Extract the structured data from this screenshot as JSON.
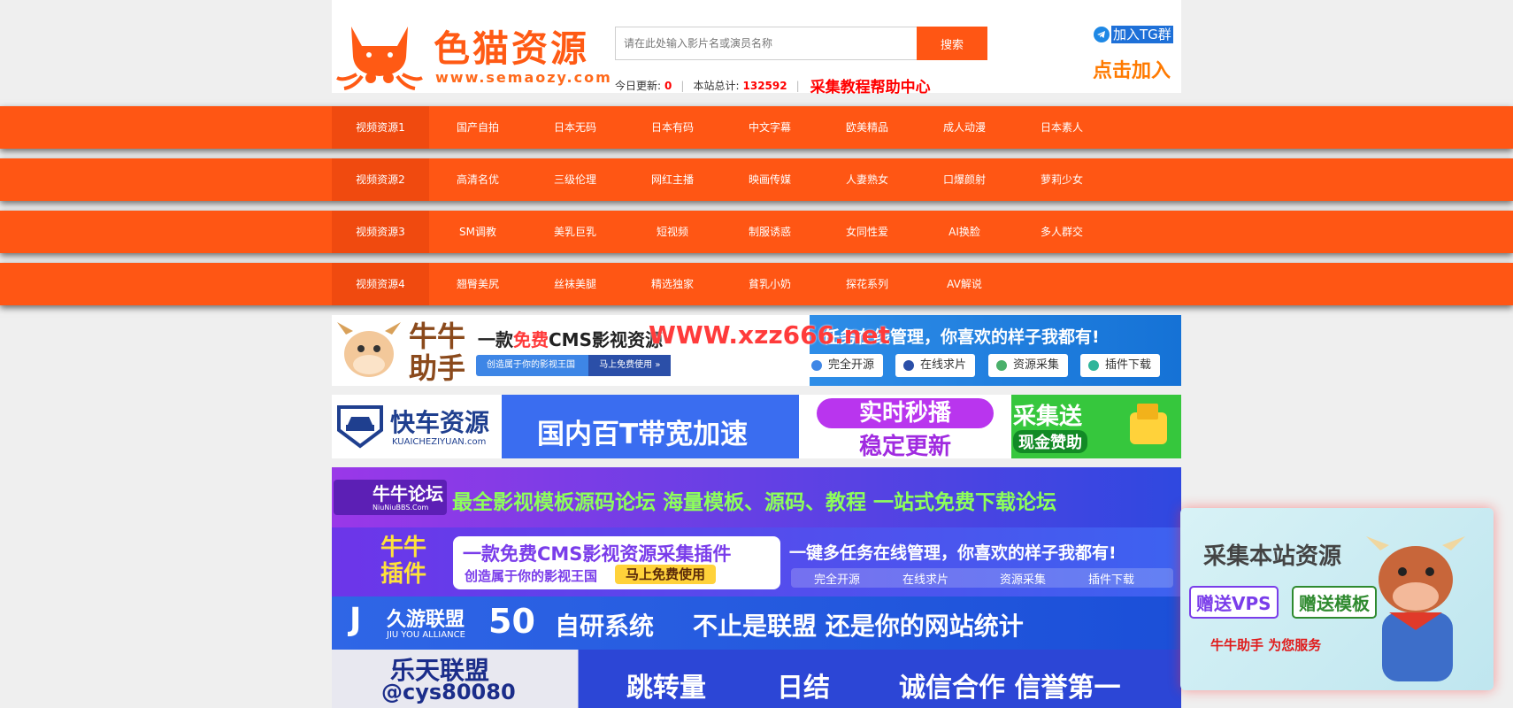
{
  "logo": {
    "name": "色猫资源",
    "url": "www.semaozy.com"
  },
  "search": {
    "placeholder": "请在此处输入影片名或演员名称",
    "button": "搜索"
  },
  "stats": {
    "today_label": "今日更新:",
    "today_value": "0",
    "total_label": "本站总计:",
    "total_value": "132592",
    "help": "采集教程帮助中心"
  },
  "tg": {
    "label": "加入TG群",
    "join": "点击加入"
  },
  "nav": [
    [
      "视频资源1",
      "国产自拍",
      "日本无码",
      "日本有码",
      "中文字幕",
      "欧美精品",
      "成人动漫",
      "日本素人"
    ],
    [
      "视频资源2",
      "高清名优",
      "三级伦理",
      "网红主播",
      "映画传媒",
      "人妻熟女",
      "口爆颜射",
      "萝莉少女"
    ],
    [
      "视频资源3",
      "SM调教",
      "美乳巨乳",
      "短视频",
      "制服诱惑",
      "女同性爱",
      "AI换脸",
      "多人群交"
    ],
    [
      "视频资源4",
      "翘臀美尻",
      "丝袜美腿",
      "精选独家",
      "貧乳小奶",
      "探花系列",
      "AV解说"
    ]
  ],
  "watermark": "WWW.xzz666.net",
  "banner1": {
    "brand": "牛牛助手",
    "title_a": "一款",
    "title_b": "免费",
    "title_c": "CMS影视资源",
    "right_title": "任务在线管理，你喜欢的样子我都有!",
    "sub_left": "创造属于你的影视王国",
    "sub_btn": "马上免费使用 »",
    "pills": [
      "完全开源",
      "在线求片",
      "资源采集",
      "插件下载"
    ]
  },
  "banner2": {
    "brand": "快车资源",
    "brand_en": "KUAICHEZIYUAN.com",
    "mid": "国内百T带宽加速",
    "right_top": "实时秒播",
    "right_bottom": "稳定更新",
    "far_top": "采集送",
    "far_bottom": "现金赞助"
  },
  "banner3": {
    "brand": "牛牛论坛",
    "brand_en": "NiuNiuBBS.Com",
    "title": "最全影视模板源码论坛 海量模板、源码、教程 一站式免费下载论坛"
  },
  "banner4": {
    "brand": "牛牛插件",
    "title": "一款免费CMS影视资源采集插件",
    "sub": "创造属于你的影视王国",
    "btn": "马上免费使用",
    "right_title": "一键多任务在线管理，你喜欢的样子我都有!",
    "items": [
      "完全开源",
      "在线求片",
      "资源采集",
      "插件下载"
    ]
  },
  "banner5": {
    "brand": "久游联盟",
    "brand_en": "JIU YOU ALLIANCE",
    "num": "50",
    "title": "自研系统",
    "title2": "不止是联盟 还是你的网站统计"
  },
  "banner6": {
    "brand": "乐天联盟",
    "handle": "@cys80080",
    "items": [
      "跳转量",
      "日结",
      "诚信合作 信誉第一"
    ]
  },
  "float_ad": {
    "title": "采集本站资源",
    "tag1": "赠送VPS",
    "tag2": "赠送模板",
    "footer": "牛牛助手 为您服务"
  }
}
